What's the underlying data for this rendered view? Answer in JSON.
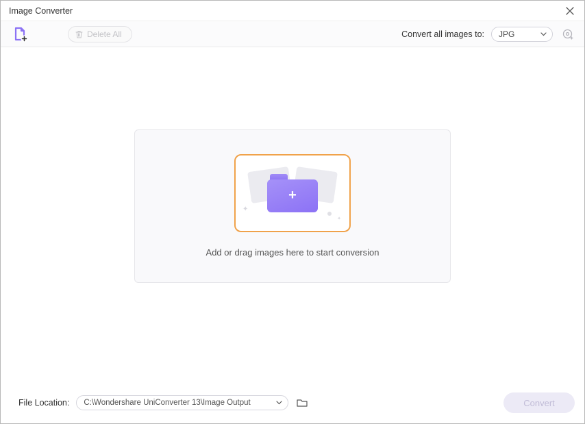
{
  "window": {
    "title": "Image Converter"
  },
  "toolbar": {
    "delete_all_label": "Delete All",
    "convert_to_label": "Convert all images to:",
    "format_selected": "JPG"
  },
  "dropzone": {
    "hint": "Add or drag images here to start conversion"
  },
  "footer": {
    "location_label": "File Location:",
    "location_path": "C:\\Wondershare UniConverter 13\\Image Output",
    "convert_label": "Convert"
  }
}
